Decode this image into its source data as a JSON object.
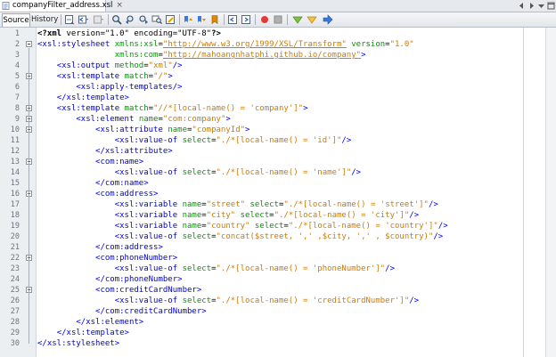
{
  "tab": {
    "file_name": "companyFilter_address.xsl",
    "close_symbol": "×"
  },
  "toolbar": {
    "source_label": "Source",
    "history_label": "History"
  },
  "editor": {
    "lines": [
      {
        "n": "1",
        "fold": false,
        "segs": [
          [
            "pi",
            "<?xml"
          ],
          [
            "txt",
            " version=\"1.0\" encoding=\"UTF-8\""
          ],
          [
            "pi",
            "?>"
          ]
        ]
      },
      {
        "n": "2",
        "fold": true,
        "segs": [
          [
            "tag",
            "<xsl:stylesheet"
          ],
          [
            "txt",
            " "
          ],
          [
            "attr",
            "xmlns:xsl"
          ],
          [
            "txt",
            "="
          ],
          [
            "url",
            "\"http://www.w3.org/1999/XSL/Transform\""
          ],
          [
            "txt",
            " "
          ],
          [
            "attr",
            "version"
          ],
          [
            "txt",
            "="
          ],
          [
            "val",
            "\"1.0\""
          ]
        ]
      },
      {
        "n": "3",
        "fold": false,
        "segs": [
          [
            "txt",
            "                "
          ],
          [
            "attr",
            "xmlns:com"
          ],
          [
            "txt",
            "="
          ],
          [
            "url",
            "\"http://mahoangnhatphi.github.io/company\""
          ],
          [
            "tag",
            ">"
          ]
        ]
      },
      {
        "n": "4",
        "fold": false,
        "segs": [
          [
            "txt",
            "    "
          ],
          [
            "tag",
            "<xsl:output"
          ],
          [
            "txt",
            " "
          ],
          [
            "attr",
            "method"
          ],
          [
            "txt",
            "="
          ],
          [
            "val",
            "\"xml\""
          ],
          [
            "tag",
            "/>"
          ]
        ]
      },
      {
        "n": "5",
        "fold": true,
        "segs": [
          [
            "txt",
            "    "
          ],
          [
            "tag",
            "<xsl:template"
          ],
          [
            "txt",
            " "
          ],
          [
            "attr",
            "match"
          ],
          [
            "txt",
            "="
          ],
          [
            "val",
            "\"/\""
          ],
          [
            "tag",
            ">"
          ]
        ]
      },
      {
        "n": "6",
        "fold": false,
        "segs": [
          [
            "txt",
            "        "
          ],
          [
            "tag",
            "<xsl:apply-templates/>"
          ]
        ]
      },
      {
        "n": "7",
        "fold": false,
        "segs": [
          [
            "txt",
            "    "
          ],
          [
            "tag",
            "</xsl:template>"
          ]
        ]
      },
      {
        "n": "8",
        "fold": true,
        "segs": [
          [
            "txt",
            "    "
          ],
          [
            "tag",
            "<xsl:template"
          ],
          [
            "txt",
            " "
          ],
          [
            "attr",
            "match"
          ],
          [
            "txt",
            "="
          ],
          [
            "val",
            "\"//*[local-name() = 'company']\""
          ],
          [
            "tag",
            ">"
          ]
        ]
      },
      {
        "n": "9",
        "fold": true,
        "segs": [
          [
            "txt",
            "        "
          ],
          [
            "tag",
            "<xsl:element"
          ],
          [
            "txt",
            " "
          ],
          [
            "attr",
            "name"
          ],
          [
            "txt",
            "="
          ],
          [
            "val",
            "\"com:company\""
          ],
          [
            "tag",
            ">"
          ]
        ]
      },
      {
        "n": "10",
        "fold": true,
        "segs": [
          [
            "txt",
            "            "
          ],
          [
            "tag",
            "<xsl:attribute"
          ],
          [
            "txt",
            " "
          ],
          [
            "attr",
            "name"
          ],
          [
            "txt",
            "="
          ],
          [
            "val",
            "\"companyId\""
          ],
          [
            "tag",
            ">"
          ]
        ]
      },
      {
        "n": "11",
        "fold": false,
        "segs": [
          [
            "txt",
            "                "
          ],
          [
            "tag",
            "<xsl:value-of"
          ],
          [
            "txt",
            " "
          ],
          [
            "attr",
            "select"
          ],
          [
            "txt",
            "="
          ],
          [
            "val",
            "\"./*[local-name() = 'id']\""
          ],
          [
            "tag",
            "/>"
          ]
        ]
      },
      {
        "n": "12",
        "fold": false,
        "segs": [
          [
            "txt",
            "            "
          ],
          [
            "tag",
            "</xsl:attribute>"
          ]
        ]
      },
      {
        "n": "13",
        "fold": true,
        "segs": [
          [
            "txt",
            "            "
          ],
          [
            "tag",
            "<com:name>"
          ]
        ]
      },
      {
        "n": "14",
        "fold": false,
        "segs": [
          [
            "txt",
            "                "
          ],
          [
            "tag",
            "<xsl:value-of"
          ],
          [
            "txt",
            " "
          ],
          [
            "attr",
            "select"
          ],
          [
            "txt",
            "="
          ],
          [
            "val",
            "\"./*[local-name() = 'name']\""
          ],
          [
            "tag",
            "/>"
          ]
        ]
      },
      {
        "n": "15",
        "fold": false,
        "segs": [
          [
            "txt",
            "            "
          ],
          [
            "tag",
            "</com:name>"
          ]
        ]
      },
      {
        "n": "16",
        "fold": true,
        "segs": [
          [
            "txt",
            "            "
          ],
          [
            "tag",
            "<com:address>"
          ]
        ]
      },
      {
        "n": "17",
        "fold": false,
        "segs": [
          [
            "txt",
            "                "
          ],
          [
            "tag",
            "<xsl:variable"
          ],
          [
            "txt",
            " "
          ],
          [
            "attr",
            "name"
          ],
          [
            "txt",
            "="
          ],
          [
            "val",
            "\"street\""
          ],
          [
            "txt",
            " "
          ],
          [
            "attr",
            "select"
          ],
          [
            "txt",
            "="
          ],
          [
            "val",
            "\"./*[local-name() = 'street']\""
          ],
          [
            "tag",
            "/>"
          ]
        ]
      },
      {
        "n": "18",
        "fold": false,
        "segs": [
          [
            "txt",
            "                "
          ],
          [
            "tag",
            "<xsl:variable"
          ],
          [
            "txt",
            " "
          ],
          [
            "attr",
            "name"
          ],
          [
            "txt",
            "="
          ],
          [
            "val",
            "\"city\""
          ],
          [
            "txt",
            " "
          ],
          [
            "attr",
            "select"
          ],
          [
            "txt",
            "="
          ],
          [
            "val",
            "\"./*[local-name() = 'city']\""
          ],
          [
            "tag",
            "/>"
          ]
        ]
      },
      {
        "n": "19",
        "fold": false,
        "segs": [
          [
            "txt",
            "                "
          ],
          [
            "tag",
            "<xsl:variable"
          ],
          [
            "txt",
            " "
          ],
          [
            "attr",
            "name"
          ],
          [
            "txt",
            "="
          ],
          [
            "val",
            "\"country\""
          ],
          [
            "txt",
            " "
          ],
          [
            "attr",
            "select"
          ],
          [
            "txt",
            "="
          ],
          [
            "val",
            "\"./*[local-name() = 'country']\""
          ],
          [
            "tag",
            "/>"
          ]
        ]
      },
      {
        "n": "20",
        "fold": false,
        "segs": [
          [
            "txt",
            "                "
          ],
          [
            "tag",
            "<xsl:value-of"
          ],
          [
            "txt",
            " "
          ],
          [
            "attr",
            "select"
          ],
          [
            "txt",
            "="
          ],
          [
            "val",
            "\"concat($street, ',' ,$city, ',' , $country)\""
          ],
          [
            "tag",
            "/>"
          ]
        ]
      },
      {
        "n": "21",
        "fold": false,
        "segs": [
          [
            "txt",
            "            "
          ],
          [
            "tag",
            "</com:address>"
          ]
        ]
      },
      {
        "n": "22",
        "fold": true,
        "segs": [
          [
            "txt",
            "            "
          ],
          [
            "tag",
            "<com:phoneNumber>"
          ]
        ]
      },
      {
        "n": "23",
        "fold": false,
        "segs": [
          [
            "txt",
            "                "
          ],
          [
            "tag",
            "<xsl:value-of"
          ],
          [
            "txt",
            " "
          ],
          [
            "attr",
            "select"
          ],
          [
            "txt",
            "="
          ],
          [
            "val",
            "\"./*[local-name() = 'phoneNumber']\""
          ],
          [
            "tag",
            "/>"
          ]
        ]
      },
      {
        "n": "24",
        "fold": false,
        "segs": [
          [
            "txt",
            "            "
          ],
          [
            "tag",
            "</com:phoneNumber>"
          ]
        ]
      },
      {
        "n": "25",
        "fold": true,
        "segs": [
          [
            "txt",
            "            "
          ],
          [
            "tag",
            "<com:creditCardNumber>"
          ]
        ]
      },
      {
        "n": "26",
        "fold": false,
        "segs": [
          [
            "txt",
            "                "
          ],
          [
            "tag",
            "<xsl:value-of"
          ],
          [
            "txt",
            " "
          ],
          [
            "attr",
            "select"
          ],
          [
            "txt",
            "="
          ],
          [
            "val",
            "\"./*[local-name() = 'creditCardNumber']\""
          ],
          [
            "tag",
            "/>"
          ]
        ]
      },
      {
        "n": "27",
        "fold": false,
        "segs": [
          [
            "txt",
            "            "
          ],
          [
            "tag",
            "</com:creditCardNumber>"
          ]
        ]
      },
      {
        "n": "28",
        "fold": false,
        "segs": [
          [
            "txt",
            "        "
          ],
          [
            "tag",
            "</xsl:element>"
          ]
        ]
      },
      {
        "n": "29",
        "fold": false,
        "segs": [
          [
            "txt",
            "    "
          ],
          [
            "tag",
            "</xsl:template>"
          ]
        ]
      },
      {
        "n": "30",
        "fold": false,
        "segs": [
          [
            "tag",
            "</xsl:stylesheet>"
          ]
        ]
      }
    ]
  },
  "colors": {
    "tag": "#0000e6",
    "attribute": "#009900",
    "value": "#ce7b00",
    "line_number": "#6b7480"
  }
}
